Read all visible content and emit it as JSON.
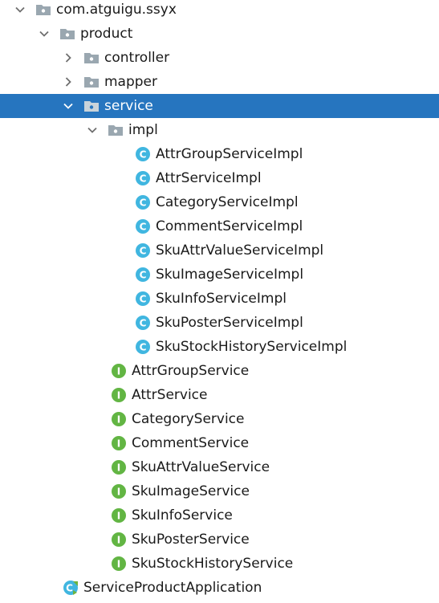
{
  "tree": {
    "root": {
      "label": "com.atguigu.ssyx"
    },
    "product": {
      "label": "product"
    },
    "controller": {
      "label": "controller"
    },
    "mapper": {
      "label": "mapper"
    },
    "service": {
      "label": "service"
    },
    "impl": {
      "label": "impl"
    },
    "impl_classes": [
      "AttrGroupServiceImpl",
      "AttrServiceImpl",
      "CategoryServiceImpl",
      "CommentServiceImpl",
      "SkuAttrValueServiceImpl",
      "SkuImageServiceImpl",
      "SkuInfoServiceImpl",
      "SkuPosterServiceImpl",
      "SkuStockHistoryServiceImpl"
    ],
    "interfaces": [
      "AttrGroupService",
      "AttrService",
      "CategoryService",
      "CommentService",
      "SkuAttrValueService",
      "SkuImageService",
      "SkuInfoService",
      "SkuPosterService",
      "SkuStockHistoryService"
    ],
    "application": {
      "label": "ServiceProductApplication"
    }
  },
  "icons": {
    "package": "package-folder-icon",
    "class": "class-icon",
    "interface": "interface-icon",
    "application": "spring-boot-application-icon",
    "expanded": "chevron-down-icon",
    "collapsed": "chevron-right-icon"
  },
  "colors": {
    "selection": "#2675bf",
    "folder": "#9aa7b0",
    "class_icon": "#40b6e0",
    "interface_icon": "#62b543",
    "spring_green": "#6db33f",
    "text": "#1a1a1a"
  }
}
